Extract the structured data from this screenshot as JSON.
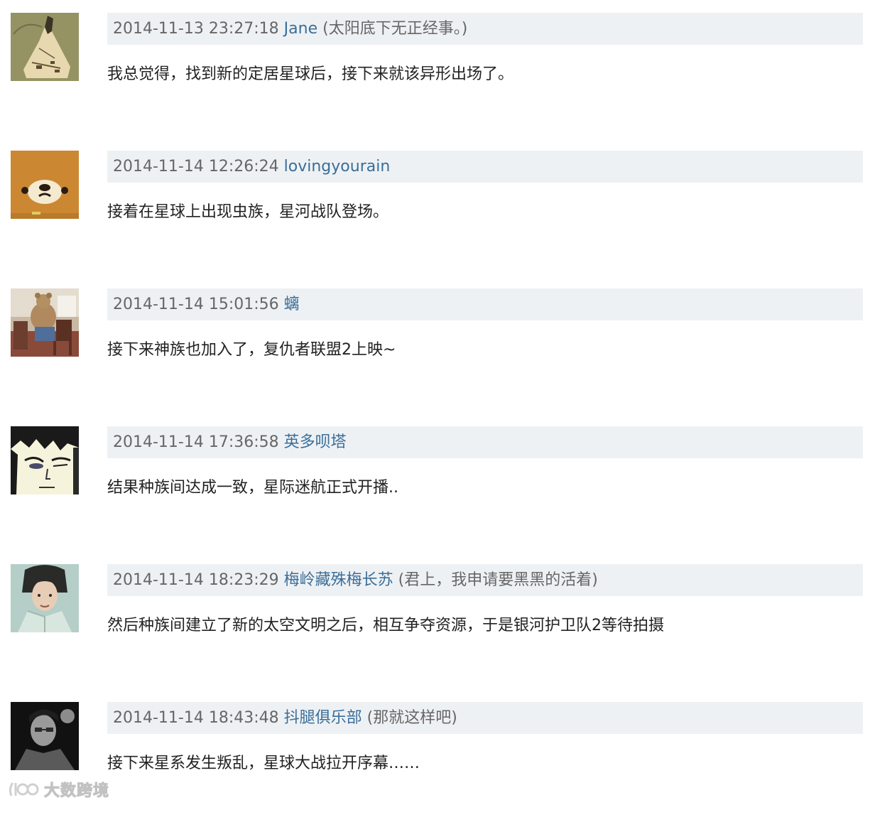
{
  "comments": [
    {
      "timestamp": "2014-11-13 23:27:18",
      "author": "Jane",
      "signature": "(太阳底下无正经事。)",
      "text": "我总觉得，找到新的定居星球后，接下来就该异形出场了。",
      "avatar": "avatar-map-illustration"
    },
    {
      "timestamp": "2014-11-14 12:26:24",
      "author": "lovingyourain",
      "signature": "",
      "text": "接着在星球上出现虫族，星河战队登场。",
      "avatar": "avatar-bear-face"
    },
    {
      "timestamp": "2014-11-14 15:01:56",
      "author": "螭",
      "signature": "",
      "text": "接下来神族也加入了，复仇者联盟2上映~",
      "avatar": "avatar-teddy-bear-photo"
    },
    {
      "timestamp": "2014-11-14 17:36:58",
      "author": "英多呗塔",
      "signature": "",
      "text": "结果种族间达成一致，星际迷航正式开播..",
      "avatar": "avatar-anime-face"
    },
    {
      "timestamp": "2014-11-14 18:23:29",
      "author": "梅岭藏殊梅长苏",
      "signature": "(君上，我申请要黑黑的活着)",
      "text": "然后种族间建立了新的太空文明之后，相互争夺资源，于是银河护卫队2等待拍摄",
      "avatar": "avatar-portrait-photo"
    },
    {
      "timestamp": "2014-11-14 18:43:48",
      "author": "抖腿俱乐部",
      "signature": "(那就这样吧)",
      "text": "接下来星系发生叛乱，星球大战拉开序幕……",
      "avatar": "avatar-bw-portrait-photo"
    }
  ],
  "watermark": {
    "text": "大数跨境",
    "logo": "watermark-logo-icon"
  }
}
